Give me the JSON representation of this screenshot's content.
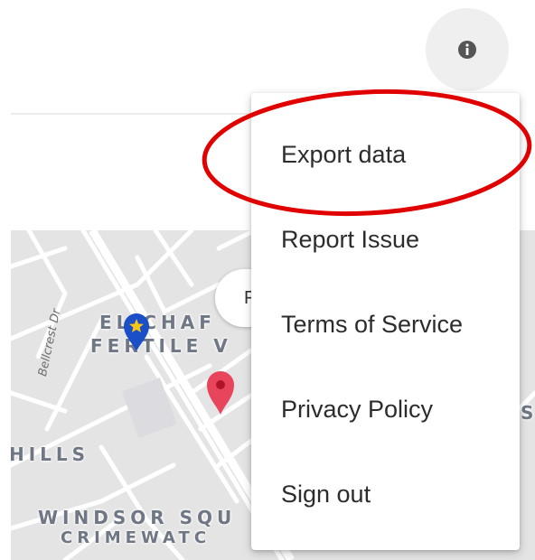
{
  "header": {
    "info_icon": "info-icon"
  },
  "menu": {
    "items": [
      {
        "label": "Export data"
      },
      {
        "label": "Report Issue"
      },
      {
        "label": "Terms of Service"
      },
      {
        "label": "Privacy Policy"
      },
      {
        "label": "Sign out"
      }
    ]
  },
  "map": {
    "labels": {
      "neighborhood_1": "EL CHAF",
      "neighborhood_1b": "FERTILE V",
      "neighborhood_2": "HILLS",
      "neighborhood_3": "WINDSOR SQU",
      "neighborhood_3b": "CRIMEWATC",
      "street": "Bellcrest Dr",
      "edge_letter": "S"
    },
    "chip_text": "F"
  },
  "annotation": {
    "color": "#e00000"
  },
  "colors": {
    "pin_blue": "#1a4fc7",
    "pin_red": "#e8455c",
    "map_bg": "#e4e4e4"
  }
}
